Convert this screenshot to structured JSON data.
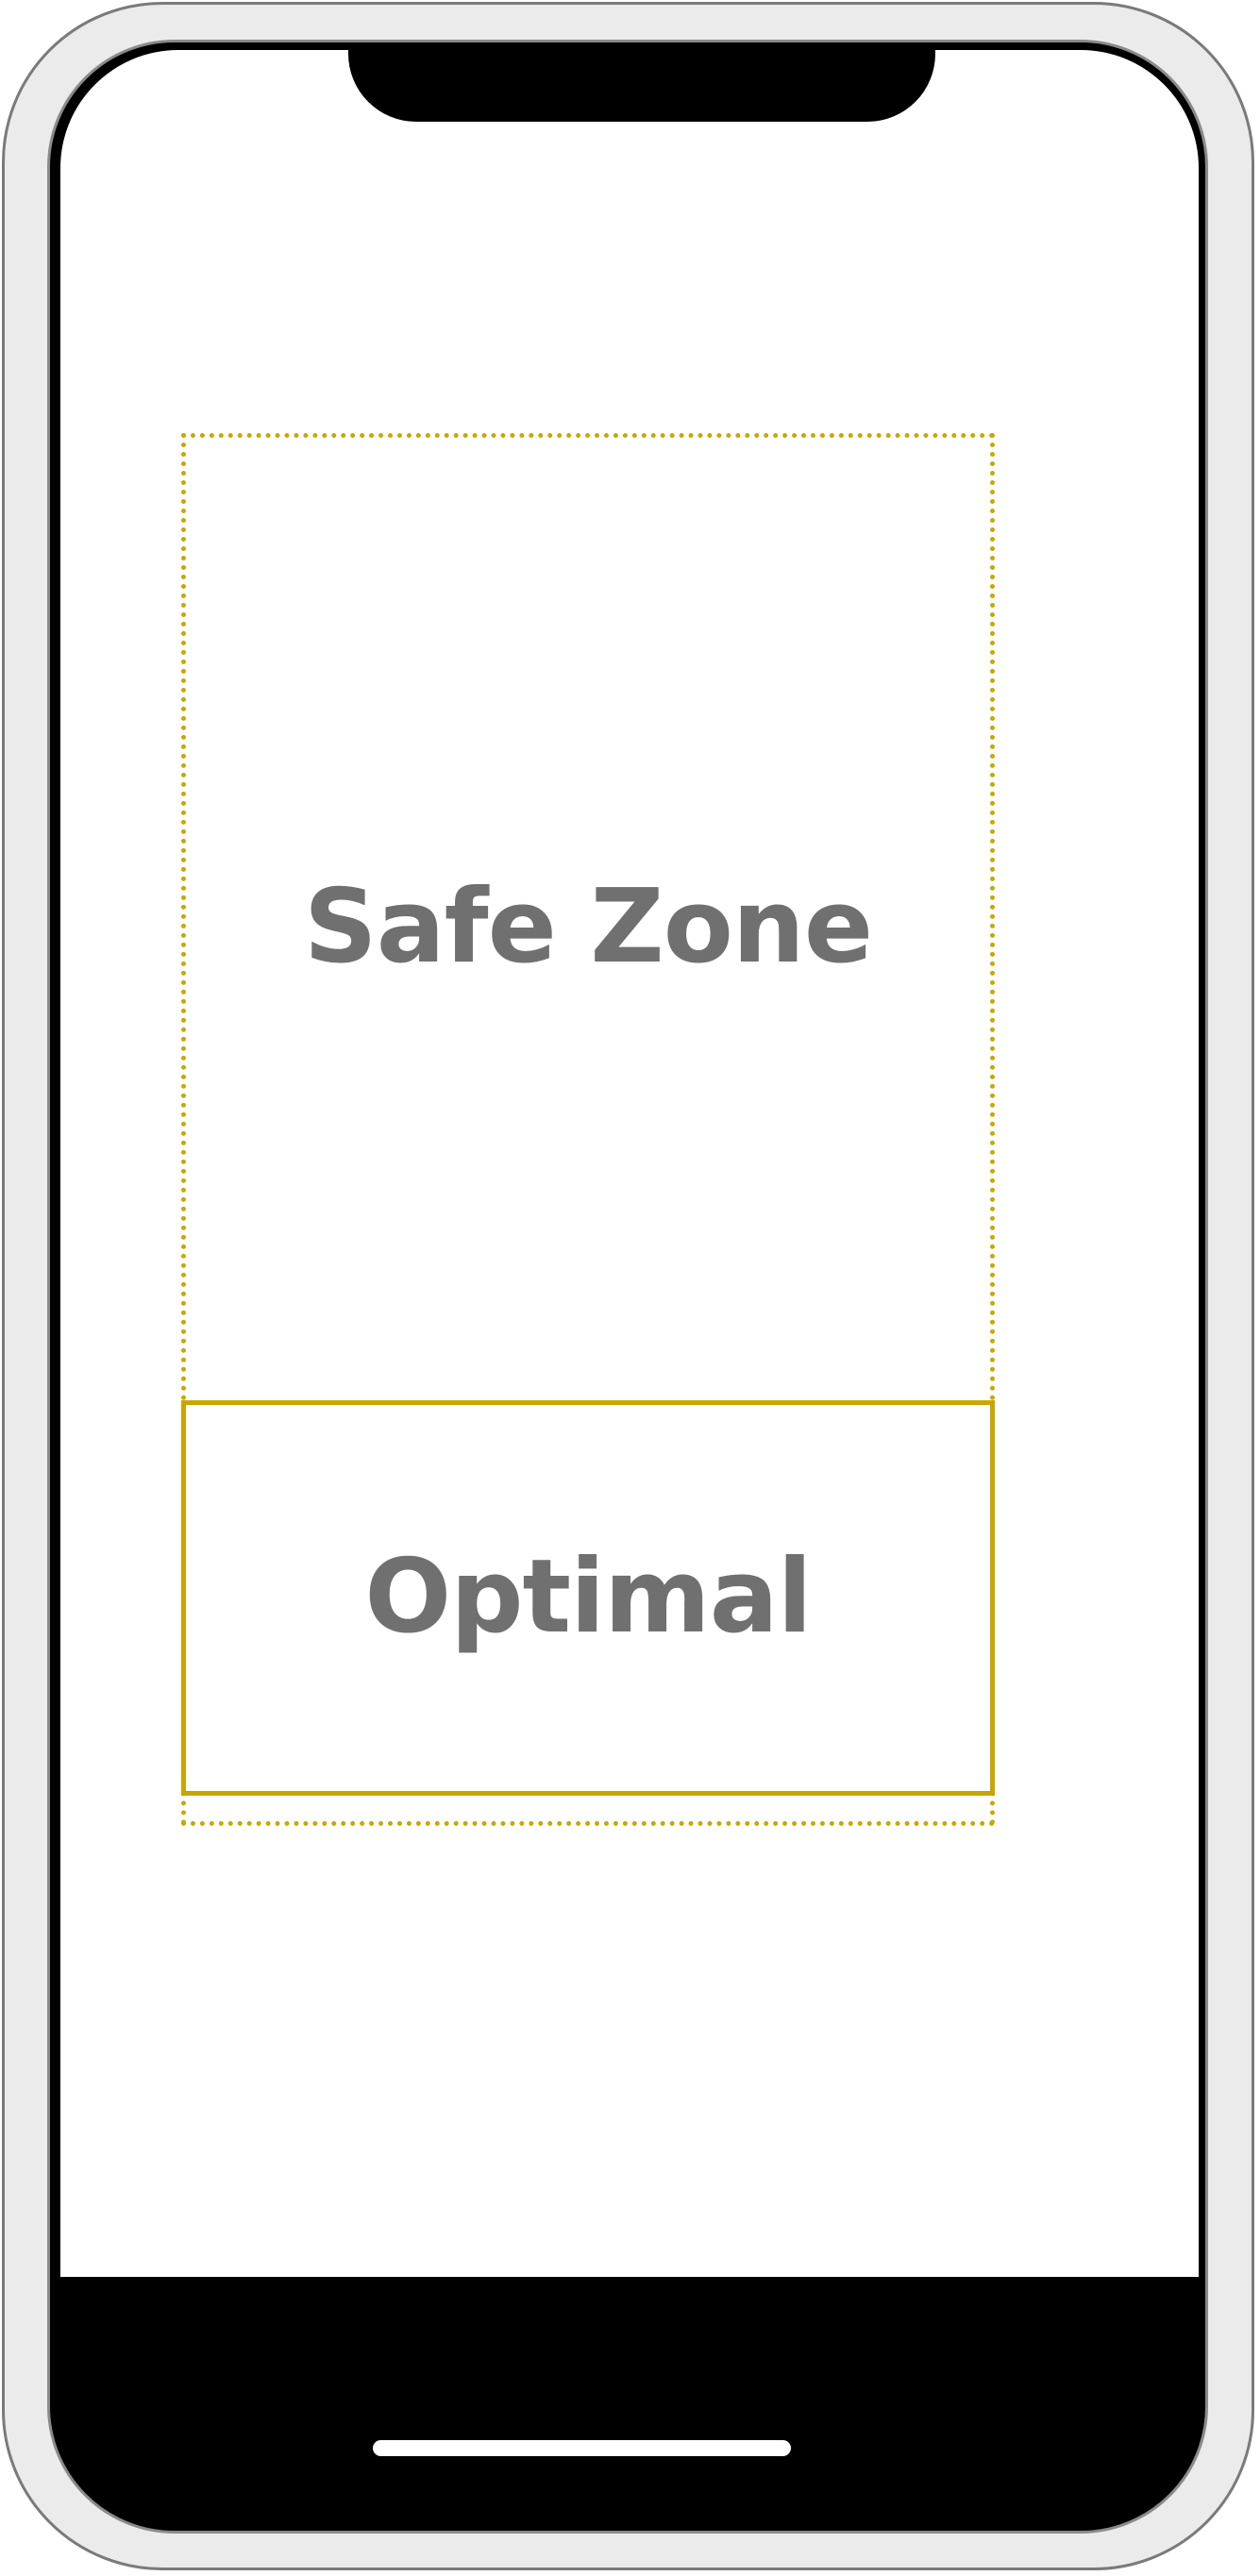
{
  "zones": {
    "safe_label": "Safe Zone",
    "optimal_label": "Optimal"
  },
  "colors": {
    "zone_border": "#c8a800",
    "label_text": "#707070",
    "frame": "#ebebeb",
    "bezel": "#000000"
  }
}
